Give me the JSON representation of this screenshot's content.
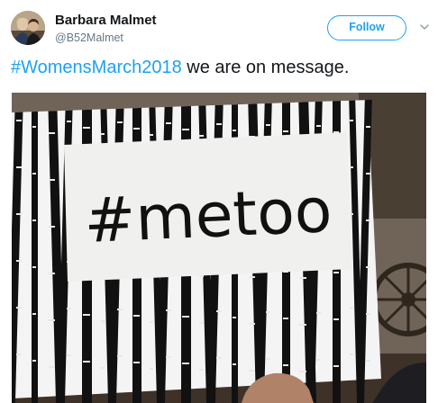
{
  "user": {
    "display_name": "Barbara Malmet",
    "handle": "@B52Malmet"
  },
  "actions": {
    "follow_label": "Follow"
  },
  "tweet": {
    "hashtag": "#WomensMarch2018",
    "text": " we are on message."
  },
  "media": {
    "sign_text": "#metoo"
  },
  "colors": {
    "accent": "#1da1f2",
    "text_primary": "#14171a",
    "text_secondary": "#657786"
  },
  "icons": {
    "avatar": "avatar",
    "more_options": "chevron-down-icon"
  }
}
